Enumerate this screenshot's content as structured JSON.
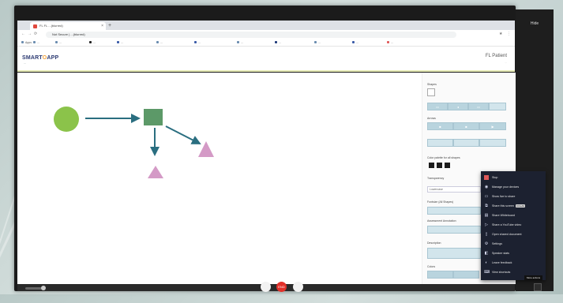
{
  "colors": {
    "bg": "#c4d2d1",
    "accent": "#2c3a72",
    "menu_bg": "#1c2130",
    "end_call": "#e2312a"
  },
  "browser": {
    "tab_title": "FL FL ...(blurred)",
    "url": "Not Secure | ...(blurred)",
    "bookmarks": [
      "Apps",
      "...",
      "...",
      "...",
      "...",
      "...",
      "...",
      "...",
      "...",
      "...",
      "...",
      "..."
    ]
  },
  "app": {
    "logo_text": "SMART",
    "logo_o": "O",
    "logo_text2": "APP",
    "patient_name": "FL Patient",
    "patient_id": "..."
  },
  "right_panel": {
    "top_label": "Hide"
  },
  "diagram": {
    "shapes": [
      "circle-green",
      "square-green",
      "triangle-pink",
      "triangle-pink"
    ],
    "arrows": 3,
    "colors": {
      "circle": "#8bc34a",
      "square": "#5c9968",
      "triangle": "#d49ac6",
      "arrow": "#2a6e80"
    }
  },
  "side_panel": {
    "shapes_label": "Shapes",
    "arrows_label": "Arrows",
    "color_label": "Color palette for all shapes",
    "transparency_label": "Transparency",
    "select_value": "Lowercase",
    "section1": "Fontsize (All Shapes)",
    "section2": "Assessment Annotation",
    "section3": "Description",
    "section4": "Colors"
  },
  "context_menu": {
    "items": [
      {
        "icon": "stop-icon",
        "label": "Stop",
        "color": "#e05a5a"
      },
      {
        "icon": "record-icon",
        "label": "Manage your devices"
      },
      {
        "icon": "monitor-icon",
        "label": "Show live to share"
      },
      {
        "icon": "screen-icon",
        "label": "Share this screen",
        "badge": "Ctrl+Alt"
      },
      {
        "icon": "board-icon",
        "label": "Share Whiteboard"
      },
      {
        "icon": "video-icon",
        "label": "Share a YouTube video"
      },
      {
        "icon": "doc-icon",
        "label": "Open shared document"
      },
      {
        "icon": "gear-icon",
        "label": "Settings"
      },
      {
        "icon": "mute-icon",
        "label": "Speaker stats"
      },
      {
        "icon": "feedback-icon",
        "label": "Leave feedback"
      },
      {
        "icon": "keyboard-icon",
        "label": "View shortcuts"
      }
    ]
  },
  "tooltip": "More actions",
  "call": {
    "end_label": "END"
  }
}
